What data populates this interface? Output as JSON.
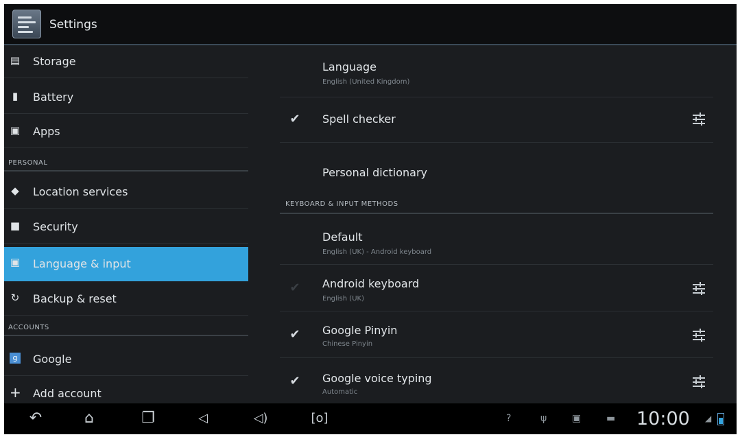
{
  "app": {
    "title": "Settings",
    "icon": "settings-app-icon"
  },
  "sidebar": {
    "items": [
      {
        "label": "Storage",
        "icon": "storage-icon",
        "selected": false
      },
      {
        "label": "Battery",
        "icon": "battery-icon",
        "selected": false
      },
      {
        "label": "Apps",
        "icon": "apps-icon",
        "selected": false
      },
      {
        "label": "Location services",
        "icon": "location-icon",
        "selected": false
      },
      {
        "label": "Security",
        "icon": "lock-icon",
        "selected": false
      },
      {
        "label": "Language & input",
        "icon": "language-icon",
        "selected": true
      },
      {
        "label": "Backup & reset",
        "icon": "backup-icon",
        "selected": false
      },
      {
        "label": "Google",
        "icon": "google-account-icon",
        "selected": false
      },
      {
        "label": "Add account",
        "icon": "add-icon",
        "selected": false
      }
    ],
    "sections": {
      "personal": "PERSONAL",
      "accounts": "ACCOUNTS"
    }
  },
  "main": {
    "language": {
      "title": "Language",
      "summary": "English (United Kingdom)"
    },
    "spell_checker": {
      "title": "Spell checker",
      "checked": true
    },
    "personal_dictionary": {
      "title": "Personal dictionary"
    },
    "keyboard_header": "KEYBOARD & INPUT METHODS",
    "default": {
      "title": "Default",
      "summary": "English (UK) - Android keyboard"
    },
    "android_keyboard": {
      "title": "Android keyboard",
      "summary": "English (UK)",
      "checked": false
    },
    "google_pinyin": {
      "title": "Google Pinyin",
      "summary": "Chinese Pinyin",
      "checked": true
    },
    "google_voice": {
      "title": "Google voice typing",
      "summary": "Automatic",
      "checked": true
    }
  },
  "system_bar": {
    "time": "10:00",
    "buttons": [
      "back-icon",
      "home-icon",
      "recent-apps-icon",
      "volume-down-icon",
      "volume-up-icon",
      "screenshot-icon"
    ],
    "status_icons": [
      "unknown-icon",
      "usb-icon",
      "image-icon",
      "keyboard-icon",
      "signal-icon",
      "battery-icon"
    ]
  },
  "colors": {
    "accent": "#33a2dc",
    "background": "#1b1d20",
    "actionbar": "#0d0e10"
  }
}
